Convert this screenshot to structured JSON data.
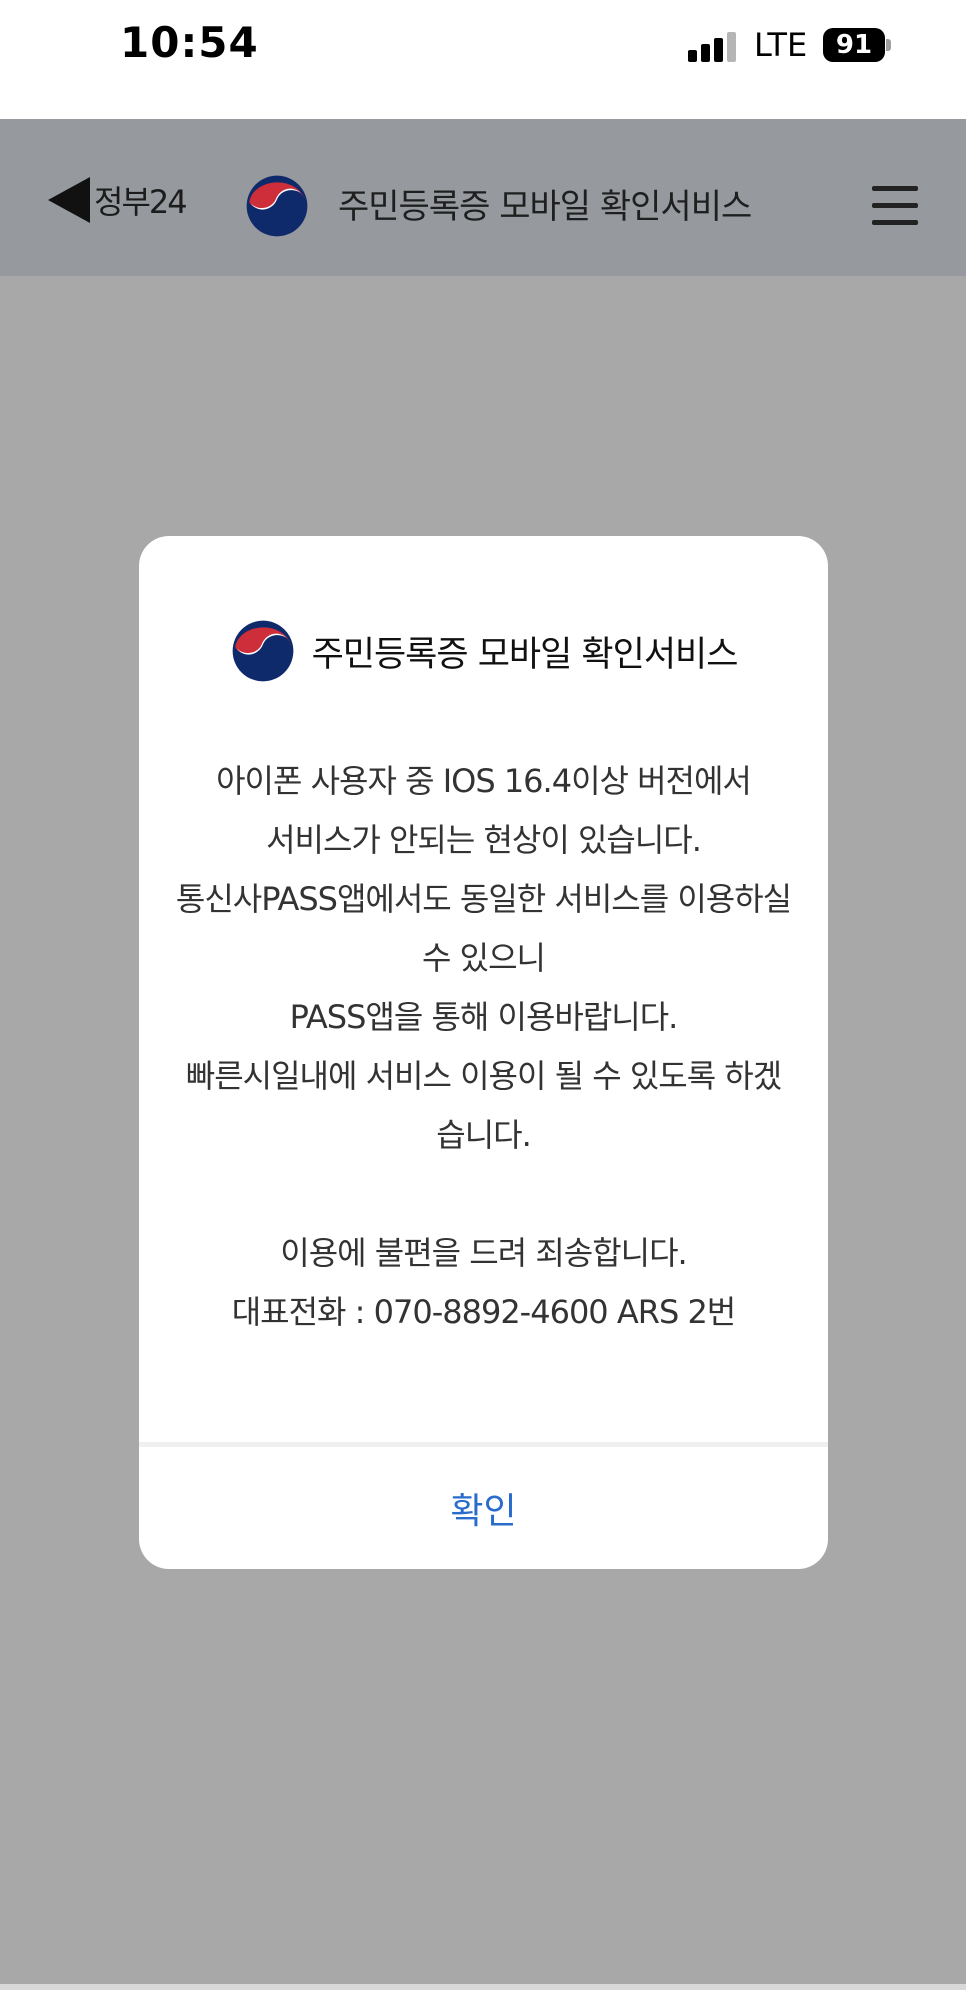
{
  "status_bar": {
    "time": "10:54",
    "network": "LTE",
    "battery": "91"
  },
  "header": {
    "back_label": "정부24",
    "title": "주민등록증 모바일 확인서비스"
  },
  "dialog": {
    "title": "주민등록증 모바일 확인서비스",
    "lines": [
      "아이폰 사용자 중 IOS 16.4이상 버전에서",
      "서비스가 안되는 현상이 있습니다.",
      "통신사PASS앱에서도 동일한 서비스를 이용하실",
      "수 있으니",
      "PASS앱을 통해 이용바랍니다.",
      "빠른시일내에 서비스 이용이 될 수 있도록 하겠",
      "습니다.",
      "",
      "이용에 불편을 드려 죄송합니다.",
      "대표전화 : 070-8892-4600 ARS 2번"
    ],
    "confirm_label": "확인"
  },
  "colors": {
    "overlay": "#a8a8a8",
    "header_bg": "#969a9e",
    "accent": "#2a6ccc",
    "emblem_red": "#cd2e3a",
    "emblem_blue": "#0f2a6b"
  }
}
